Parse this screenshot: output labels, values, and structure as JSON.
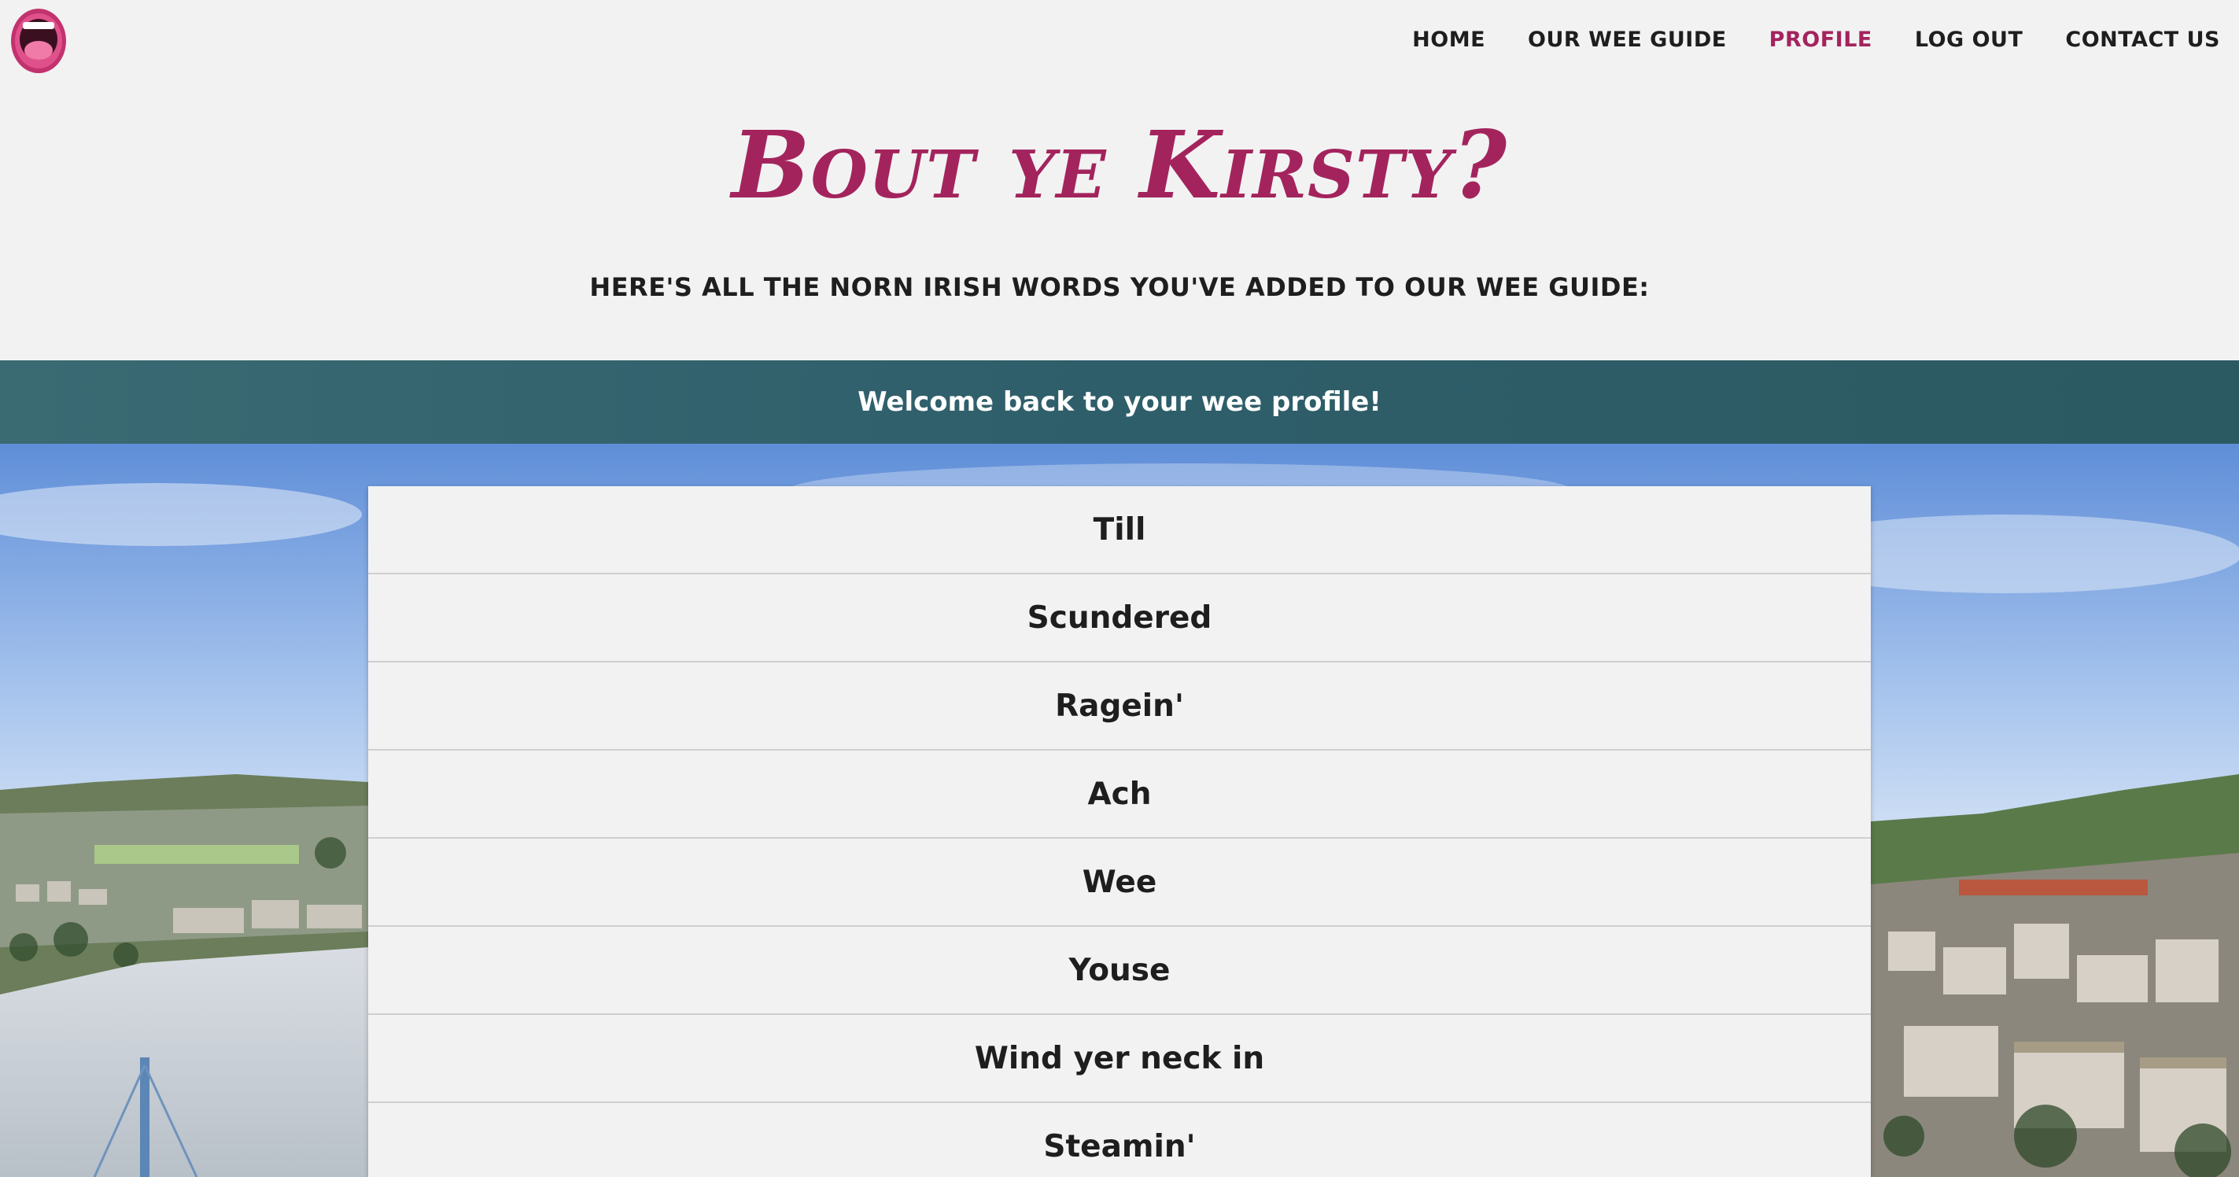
{
  "navbar": {
    "logo_icon": "open-mouth-logo-icon",
    "links": [
      {
        "label": "HOME",
        "active": false
      },
      {
        "label": "OUR WEE GUIDE",
        "active": false
      },
      {
        "label": "PROFILE",
        "active": true
      },
      {
        "label": "LOG OUT",
        "active": false
      },
      {
        "label": "CONTACT US",
        "active": false
      }
    ]
  },
  "hero": {
    "title": "Bout ye Kirsty?",
    "subtitle": "HERE'S ALL THE NORN IRISH WORDS YOU'VE ADDED TO OUR WEE GUIDE:"
  },
  "flash": {
    "message": "Welcome back to your wee profile!"
  },
  "words": [
    "Till",
    "Scundered",
    "Ragein'",
    "Ach",
    "Wee",
    "Youse",
    "Wind yer neck in",
    "Steamin'"
  ],
  "colors": {
    "accent": "#a3245d",
    "banner": "#2e5e6a",
    "page_bg": "#f2f2f2",
    "text": "#1e1e1e"
  }
}
